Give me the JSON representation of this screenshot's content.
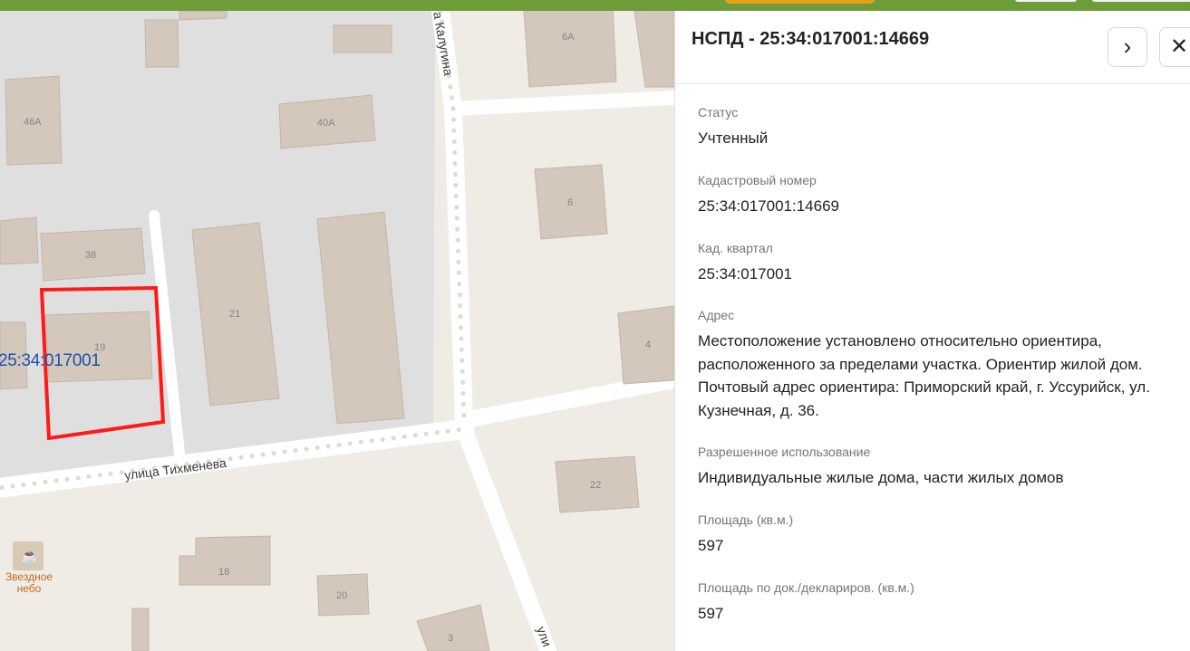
{
  "map": {
    "parcel_label": "25:34:017001",
    "street_names": {
      "bottom": "улица Тихменева",
      "vertical_top": "а Калугина",
      "vertical_bottom": "ули"
    },
    "house_numbers": [
      "6А",
      "46А",
      "40А",
      "6",
      "38",
      "21",
      "19",
      "4",
      "22",
      "18",
      "20",
      "3"
    ],
    "poi": {
      "name_line1": "Звездное",
      "name_line2": "небо",
      "icon": "cafe-cup-icon"
    },
    "colors": {
      "parcel_outline": "#ff1a1a",
      "parcel_label": "#1f4fae",
      "poi": "#c46a1a"
    }
  },
  "panel": {
    "title": "НСПД - 25:34:017001:14669",
    "next_icon": "chevron-right-icon",
    "close_icon": "close-icon",
    "fields": [
      {
        "label": "Статус",
        "value": "Учтенный"
      },
      {
        "label": "Кадастровый номер",
        "value": "25:34:017001:14669"
      },
      {
        "label": "Кад. квартал",
        "value": "25:34:017001"
      },
      {
        "label": "Адрес",
        "value": "Местоположение установлено относительно ориентира, расположенного за пределами участка. Ориентир жилой дом. Почтовый адрес ориентира: Приморский край, г. Уссурийск, ул. Кузнечная, д. 36."
      },
      {
        "label": "Разрешенное использование",
        "value": "Индивидуальные жилые дома, части жилых домов"
      },
      {
        "label": "Площадь (кв.м.)",
        "value": "597"
      },
      {
        "label": "Площадь по док./деклариров. (кв.м.)",
        "value": "597"
      }
    ]
  },
  "topbar": {
    "color": "#6e9c39"
  }
}
